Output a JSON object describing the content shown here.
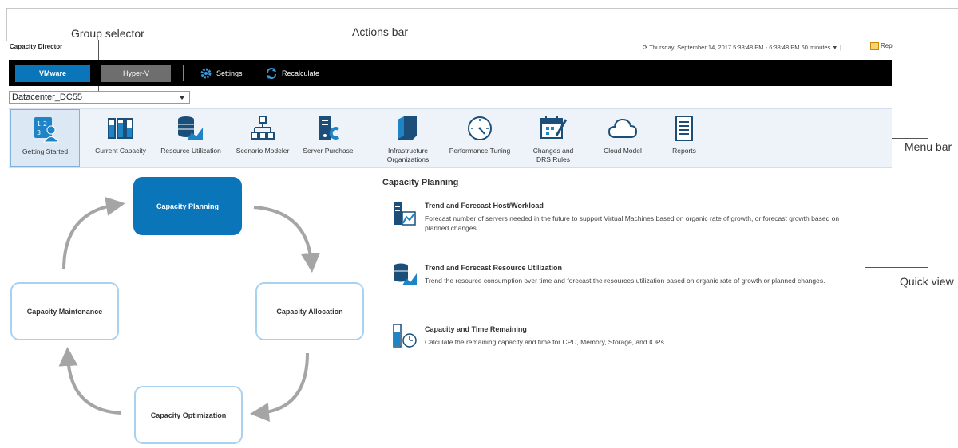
{
  "callouts": {
    "group_selector": "Group selector",
    "actions_bar": "Actions bar",
    "menu_bar": "Menu bar",
    "quick_view": "Quick view"
  },
  "header": {
    "app_title": "Capacity Director",
    "datetime": "Thursday, September 14, 2017 5:38:48 PM - 6:38:48 PM 60 minutes",
    "reports_label": "Rep"
  },
  "actions": {
    "vmware": "VMware",
    "hyperv": "Hyper-V",
    "settings": "Settings",
    "recalculate": "Recalculate"
  },
  "group_selector": {
    "value": "Datacenter_DC55"
  },
  "menu": {
    "items": [
      {
        "label": "Getting Started",
        "icon": "getting-started-icon",
        "active": true
      },
      {
        "label": "Current Capacity",
        "icon": "current-capacity-icon"
      },
      {
        "label": "Resource Utilization",
        "icon": "resource-utilization-icon"
      },
      {
        "label": "Scenario Modeler",
        "icon": "scenario-modeler-icon"
      },
      {
        "label": "Server Purchase",
        "icon": "server-purchase-icon"
      },
      {
        "label": "Infrastructure Organizations",
        "icon": "infrastructure-organizations-icon"
      },
      {
        "label": "Performance Tuning",
        "icon": "performance-tuning-icon"
      },
      {
        "label": "Changes and DRS Rules",
        "icon": "changes-drs-rules-icon"
      },
      {
        "label": "Cloud Model",
        "icon": "cloud-model-icon"
      },
      {
        "label": "Reports",
        "icon": "reports-icon"
      }
    ]
  },
  "cycle": {
    "planning": "Capacity Planning",
    "allocation": "Capacity Allocation",
    "optimization": "Capacity Optimization",
    "maintenance": "Capacity Maintenance"
  },
  "quick_view": {
    "heading": "Capacity Planning",
    "items": [
      {
        "title": "Trend and Forecast Host/Workload",
        "desc_line1": "Forecast number of servers needed in the future to support Virtual Machines based on organic rate of growth, or forecast growth based on",
        "desc_line2": "planned changes.",
        "icon": "host-workload-forecast-icon"
      },
      {
        "title": "Trend and Forecast Resource Utilization",
        "desc_line1": "Trend the resource consumption over time and forecast the resources utilization based on organic rate of growth or planned changes.",
        "desc_line2": "",
        "icon": "resource-forecast-icon"
      },
      {
        "title": "Capacity and Time Remaining",
        "desc_line1": "Calculate the remaining capacity and time for CPU, Memory, Storage, and IOPs.",
        "desc_line2": "",
        "icon": "time-remaining-icon"
      }
    ]
  },
  "colors": {
    "accent": "#0a75b8",
    "light_accent": "#a9d1f0",
    "bar_bg": "#000000",
    "menu_bg": "#eef3f9"
  }
}
